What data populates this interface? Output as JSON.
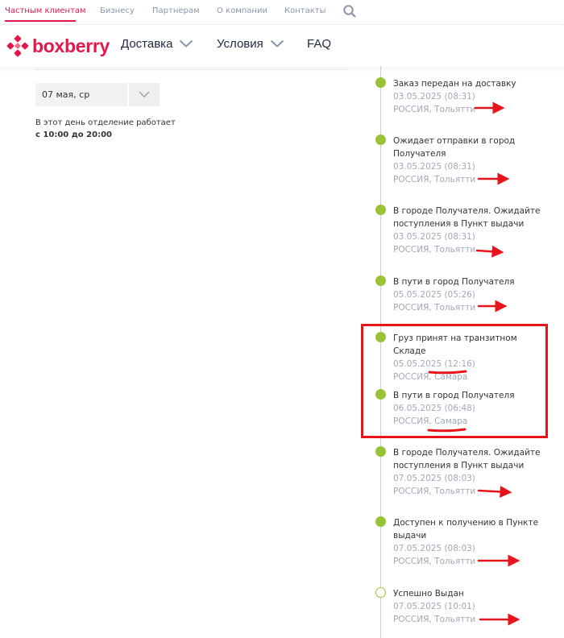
{
  "topnav": {
    "links": [
      {
        "label": "Частным клиентам",
        "active": true
      },
      {
        "label": "Бизнесу"
      },
      {
        "label": "Партнерам"
      },
      {
        "label": "О компании"
      },
      {
        "label": "Контакты"
      }
    ],
    "search_icon": "search-icon"
  },
  "header": {
    "logo_text": "boxberry",
    "nav": [
      {
        "label": "Доставка",
        "has_dropdown": true
      },
      {
        "label": "Условия",
        "has_dropdown": true
      },
      {
        "label": "FAQ",
        "has_dropdown": false
      }
    ]
  },
  "left": {
    "date_value": "07 мая, ср",
    "note_text": "В этот день отделение работает",
    "note_hours": "с 10:00 до 20:00"
  },
  "timeline": {
    "events": [
      {
        "title": "Заказ передан на доставку",
        "date": "03.05.2025 (08:31)",
        "location": "РОССИЯ, Тольятти",
        "status": "done"
      },
      {
        "title": "Ожидает отправки в город Получателя",
        "date": "03.05.2025 (08:31)",
        "location": "РОССИЯ, Тольятти",
        "status": "done"
      },
      {
        "title": "В городе Получателя. Ожидайте поступления в Пункт выдачи",
        "date": "03.05.2025 (08:31)",
        "location": "РОССИЯ, Тольятти",
        "status": "done"
      },
      {
        "title": "В пути в город Получателя",
        "date": "05.05.2025 (05:26)",
        "location": "РОССИЯ, Тольятти",
        "status": "done"
      },
      {
        "title": "Груз принят на транзитном Складе",
        "date": "05.05.2025 (12:16)",
        "location": "РОССИЯ, Самара",
        "status": "done"
      },
      {
        "title": "В пути в город Получателя",
        "date": "06.05.2025 (06:48)",
        "location": "РОССИЯ, Самара",
        "status": "done"
      },
      {
        "title": "В городе Получателя. Ожидайте поступления в Пункт выдачи",
        "date": "07.05.2025 (08:03)",
        "location": "РОССИЯ, Тольятти",
        "status": "done"
      },
      {
        "title": "Доступен к получению в Пункте выдачи",
        "date": "07.05.2025 (08:03)",
        "location": "РОССИЯ, Тольятти",
        "status": "done"
      },
      {
        "title": "Успешно Выдан",
        "date": "07.05.2025 (10:01)",
        "location": "РОССИЯ, Тольятти",
        "status": "current"
      }
    ]
  },
  "colors": {
    "brand": "#e4174b",
    "timeline_dot": "#98c337",
    "muted_text": "#a0a9b8",
    "annotation": "#e8141b"
  }
}
